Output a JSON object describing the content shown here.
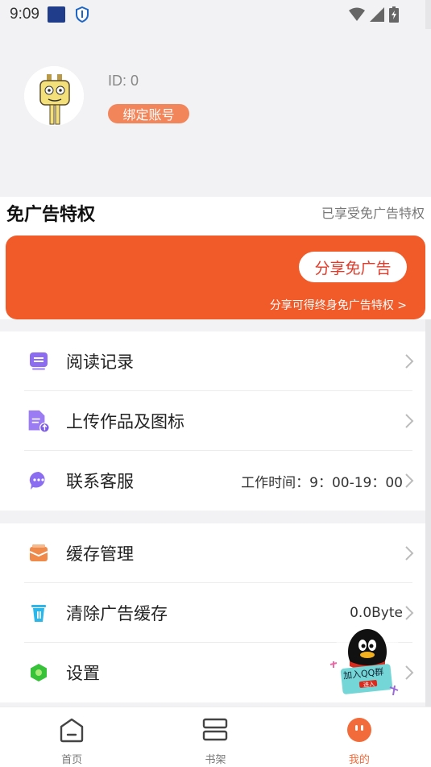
{
  "statusbar": {
    "time": "9:09"
  },
  "profile": {
    "id_text": "ID: 0",
    "bind_label": "绑定账号"
  },
  "adfree": {
    "title": "免广告特权",
    "status": "已享受免广告特权",
    "share_button": "分享免广告",
    "share_hint": "分享可得终身免广告特权 >"
  },
  "menu": {
    "group1": [
      {
        "label": "阅读记录",
        "value": "",
        "icon": "read-history-icon",
        "color": "#8c6cf0"
      },
      {
        "label": "上传作品及图标",
        "value": "",
        "icon": "upload-doc-icon",
        "color": "#9b7cf2"
      },
      {
        "label": "联系客服",
        "value": "工作时间：9：00-19：00",
        "icon": "chat-bubble-icon",
        "color": "#8a6df0"
      }
    ],
    "group2": [
      {
        "label": "缓存管理",
        "value": "",
        "icon": "cache-box-icon",
        "color": "#f08a4b"
      },
      {
        "label": "清除广告缓存",
        "value": "0.0Byte",
        "icon": "trash-icon",
        "color": "#2bb7ea"
      },
      {
        "label": "设置",
        "value": "",
        "icon": "settings-hex-icon",
        "color": "#37c23a"
      }
    ]
  },
  "qq_float": {
    "label": "加入QQ群",
    "sub": "进入"
  },
  "tabbar": {
    "tabs": [
      {
        "label": "首页",
        "icon": "home-icon"
      },
      {
        "label": "书架",
        "icon": "bookshelf-icon"
      },
      {
        "label": "我的",
        "icon": "profile-face-icon",
        "active": true
      }
    ],
    "accent": "#f26b3a"
  }
}
